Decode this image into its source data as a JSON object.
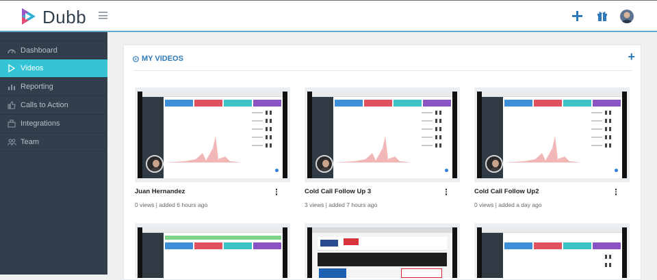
{
  "app": {
    "name": "Dubb"
  },
  "sidebar": {
    "items": [
      {
        "label": "Dashboard",
        "icon": "dashboard-icon",
        "active": false
      },
      {
        "label": "Videos",
        "icon": "play-icon",
        "active": true
      },
      {
        "label": "Reporting",
        "icon": "bar-chart-icon",
        "active": false
      },
      {
        "label": "Calls to Action",
        "icon": "thumbs-up-icon",
        "active": false
      },
      {
        "label": "Integrations",
        "icon": "integrations-icon",
        "active": false
      },
      {
        "label": "Team",
        "icon": "team-icon",
        "active": false
      }
    ]
  },
  "main": {
    "title": "MY VIDEOS",
    "videos": [
      {
        "title": "Juan Hernandez",
        "meta": "0 views | added 6 hours ago"
      },
      {
        "title": "Cold Call Follow Up 3",
        "meta": "3 views | added 7 hours ago"
      },
      {
        "title": "Cold Call Follow Up2",
        "meta": "0 views | added a day ago"
      }
    ]
  },
  "colors": {
    "accent": "#35c4d6",
    "link": "#2c78b8",
    "sidebar": "#323e4b"
  }
}
